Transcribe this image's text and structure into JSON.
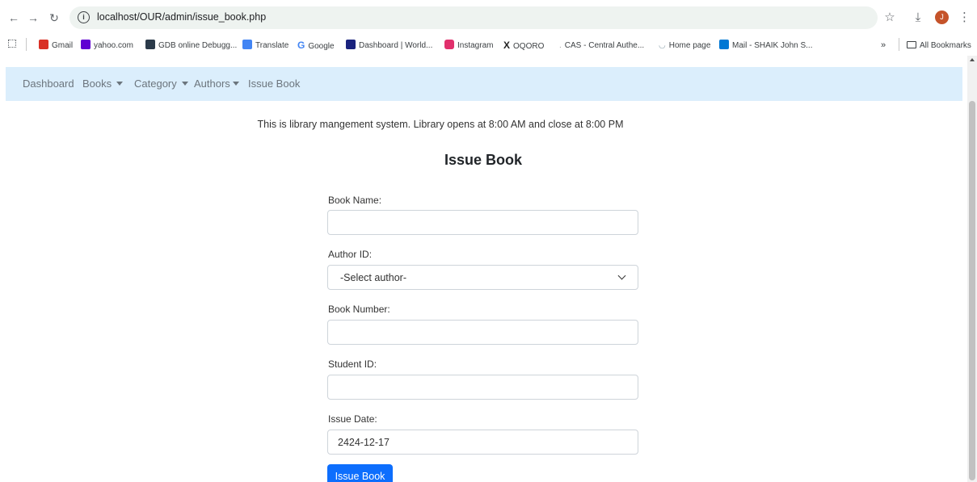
{
  "browser": {
    "url": "localhost/OUR/admin/issue_book.php",
    "avatar_letter": "J",
    "bookmarks": [
      {
        "label": "Gmail",
        "color": "#d93025"
      },
      {
        "label": "yahoo.com",
        "color": "#6001d2"
      },
      {
        "label": "GDB online Debugg...",
        "color": "#2b3a4a"
      },
      {
        "label": "Translate",
        "color": "#4285f4"
      },
      {
        "label": "Google",
        "color": "#4285f4"
      },
      {
        "label": "Dashboard | World...",
        "color": "#1a237e"
      },
      {
        "label": "Instagram",
        "color": "#e1306c"
      },
      {
        "label": "OQORO",
        "color": "#222222"
      },
      {
        "label": "CAS - Central Authe...",
        "color": "#9e9e9e"
      },
      {
        "label": "Home page",
        "color": "#90a4ae"
      },
      {
        "label": "Mail - SHAIK John S...",
        "color": "#0078d4"
      }
    ],
    "more_label": "»",
    "all_bookmarks": "All Bookmarks"
  },
  "navbar": {
    "items": [
      "Dashboard",
      "Books",
      "Category",
      "Authors",
      "Issue Book"
    ]
  },
  "notice": "This is library mangement system. Library opens at 8:00 AM and close at 8:00 PM",
  "title": "Issue Book",
  "form": {
    "book_name_label": "Book Name:",
    "book_name_value": "",
    "author_label": "Author ID:",
    "author_selected": "-Select author-",
    "book_number_label": "Book Number:",
    "book_number_value": "",
    "student_id_label": "Student ID:",
    "student_id_value": "",
    "issue_date_label": "Issue Date:",
    "issue_date_value": "2424-12-17",
    "submit_label": "Issue Book"
  },
  "colors": {
    "navbar_bg": "#dbeefc",
    "primary": "#0d6efd"
  }
}
